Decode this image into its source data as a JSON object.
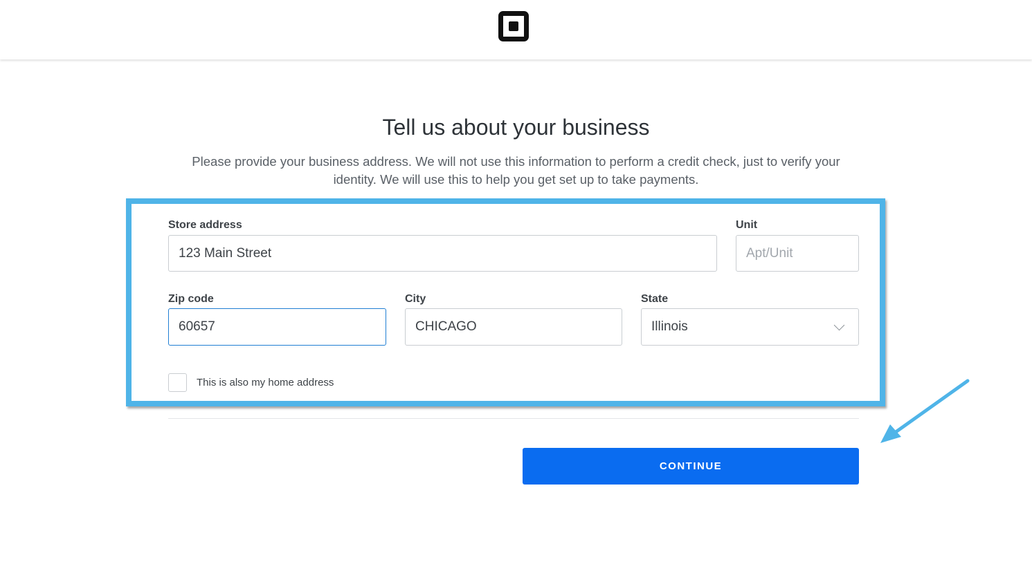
{
  "header": {
    "logo_icon": "square-logo-icon"
  },
  "main": {
    "title": "Tell us about your business",
    "description": "Please provide your business address. We will not use this information to perform a credit check, just to verify your identity. We will use this to help you get set up to take payments."
  },
  "form": {
    "store_address": {
      "label": "Store address",
      "value": "123 Main Street"
    },
    "unit": {
      "label": "Unit",
      "value": "",
      "placeholder": "Apt/Unit"
    },
    "zip": {
      "label": "Zip code",
      "value": "60657"
    },
    "city": {
      "label": "City",
      "value": "CHICAGO"
    },
    "state": {
      "label": "State",
      "selected": "Illinois",
      "icon": "chevron-down-icon"
    },
    "home_address_checkbox": {
      "label": "This is also my home address",
      "checked": false
    }
  },
  "actions": {
    "continue_label": "CONTINUE"
  },
  "annotation": {
    "highlight_color": "#4fb4e8",
    "arrow_color": "#4fb4e8"
  },
  "colors": {
    "primary_button": "#0a6cf0",
    "focus_border": "#1f7ed3"
  }
}
